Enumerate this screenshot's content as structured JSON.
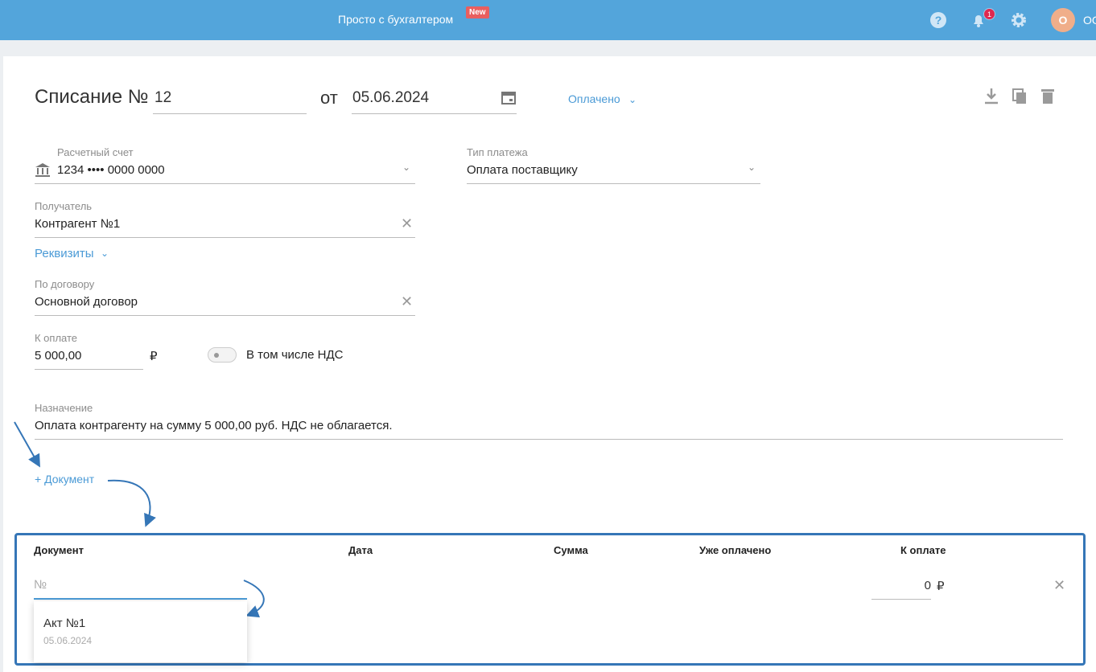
{
  "header": {
    "brand": "Просто с бухгалтером",
    "new_badge": "New",
    "notifications": "1",
    "avatar_letter": "О",
    "user_name": "ОО"
  },
  "doc": {
    "title": "Списание №",
    "number": "12",
    "from": "от",
    "date": "05.06.2024",
    "status": "Оплачено"
  },
  "fields": {
    "account_label": "Расчетный счет",
    "account_value": "1234 •••• 0000 0000",
    "payment_type_label": "Тип платежа",
    "payment_type_value": "Оплата поставщику",
    "recipient_label": "Получатель",
    "recipient_value": "Контрагент №1",
    "requisites": "Реквизиты",
    "contract_label": "По договору",
    "contract_value": "Основной договор",
    "amount_label": "К оплате",
    "amount_value": "5 000,00",
    "currency": "₽",
    "vat_label": "В том числе НДС",
    "purpose_label": "Назначение",
    "purpose_value": "Оплата контрагенту на сумму 5 000,00 руб. НДС не облагается."
  },
  "add_document": "+ Документ",
  "table": {
    "headers": [
      "Документ",
      "Дата",
      "Сумма",
      "Уже оплачено",
      "К оплате"
    ],
    "doc_placeholder": "№",
    "to_pay": "0",
    "currency": "₽"
  },
  "suggestion": {
    "title": "Акт №1",
    "date": "05.06.2024"
  }
}
